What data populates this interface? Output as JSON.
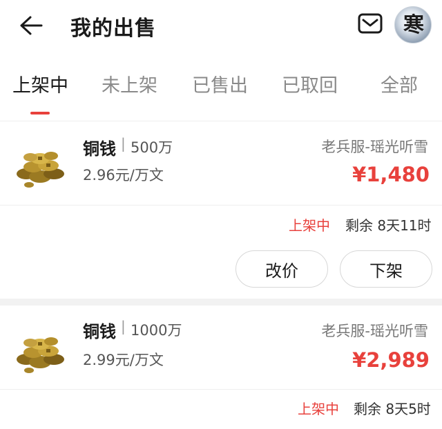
{
  "header": {
    "title": "我的出售",
    "back_icon": "arrow-left-icon",
    "mail_icon": "mail-icon",
    "avatar_glyph": "寒"
  },
  "tabs": [
    {
      "label": "上架中",
      "active": true
    },
    {
      "label": "未上架",
      "active": false
    },
    {
      "label": "已售出",
      "active": false
    },
    {
      "label": "已取回",
      "active": false
    },
    {
      "label": "全部",
      "active": false
    }
  ],
  "colors": {
    "accent": "#e8413c",
    "text": "#1a1a1a",
    "muted": "#8a8a8a"
  },
  "listings": [
    {
      "name": "铜钱",
      "separator": "|",
      "quantity": "500万",
      "rate": "2.96元/万文",
      "server": "老兵服-瑶光听雪",
      "price": "¥1,480",
      "status": "上架中",
      "remaining": "剩余 8天11时",
      "actions": {
        "change_price": "改价",
        "delist": "下架"
      }
    },
    {
      "name": "铜钱",
      "separator": "|",
      "quantity": "1000万",
      "rate": "2.99元/万文",
      "server": "老兵服-瑶光听雪",
      "price": "¥2,989",
      "status": "上架中",
      "remaining": "剩余 8天5时"
    }
  ]
}
